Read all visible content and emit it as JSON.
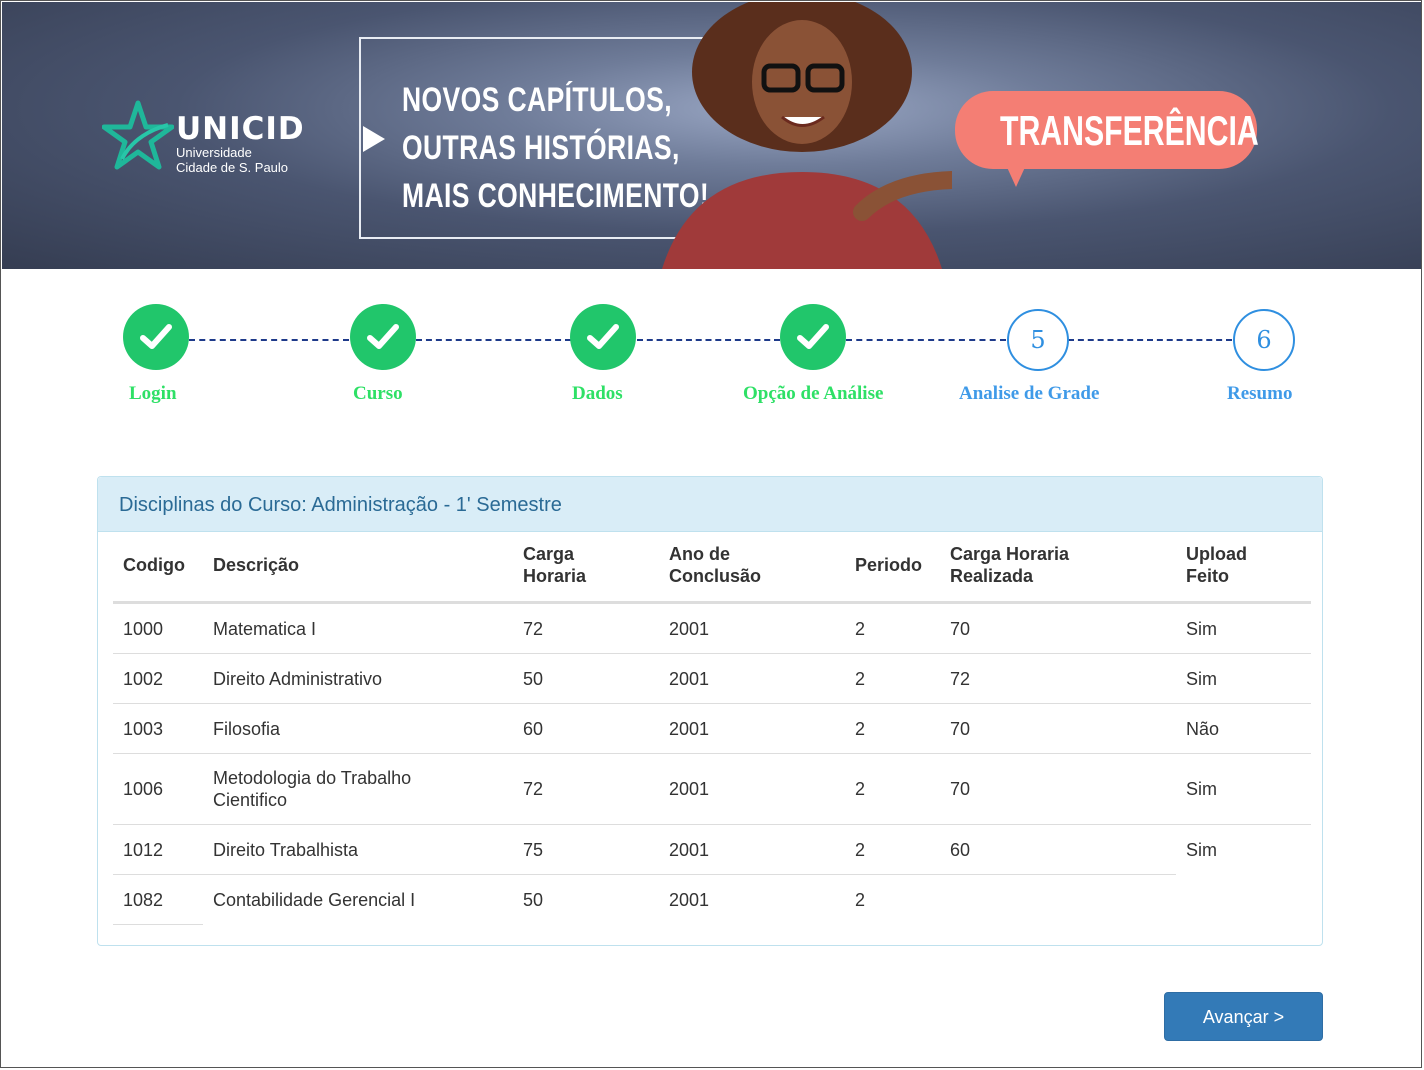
{
  "banner": {
    "logo_brand": "UNICID",
    "logo_line1": "Universidade",
    "logo_line2": "Cidade de S. Paulo",
    "slogan_line1": "NOVOS CAPÍTULOS,",
    "slogan_line2": "OUTRAS HISTÓRIAS,",
    "slogan_line3": "MAIS CONHECIMENTO!",
    "bubble_text": "TRANSFERÊNCIA"
  },
  "stepper": {
    "steps": [
      {
        "label": "Login",
        "state": "done"
      },
      {
        "label": "Curso",
        "state": "done"
      },
      {
        "label": "Dados",
        "state": "done"
      },
      {
        "label": "Opção de Análise",
        "state": "done"
      },
      {
        "label": "Analise de Grade",
        "state": "todo",
        "number": "5"
      },
      {
        "label": "Resumo",
        "state": "todo",
        "number": "6"
      }
    ],
    "done_color": "#21c66b",
    "todo_color": "#2f8fe0"
  },
  "panel": {
    "title": "Disciplinas do Curso: Administração - 1' Semestre",
    "headers": {
      "codigo": "Codigo",
      "descricao": "Descrição",
      "carga_l1": "Carga",
      "carga_l2": "Horaria",
      "ano_l1": "Ano de",
      "ano_l2": "Conclusão",
      "periodo": "Periodo",
      "realizada_l1": "Carga Horaria",
      "realizada_l2": "Realizada",
      "upload_l1": "Upload",
      "upload_l2": "Feito"
    },
    "rows": [
      {
        "codigo": "1000",
        "descricao_l1": "Matematica I",
        "descricao_l2": "",
        "carga": "72",
        "ano": "2001",
        "periodo": "2",
        "realizada": "70",
        "upload": "Sim"
      },
      {
        "codigo": "1002",
        "descricao_l1": "Direito Administrativo",
        "descricao_l2": "",
        "carga": "50",
        "ano": "2001",
        "periodo": "2",
        "realizada": "72",
        "upload": "Sim"
      },
      {
        "codigo": "1003",
        "descricao_l1": "Filosofia",
        "descricao_l2": "",
        "carga": "60",
        "ano": "2001",
        "periodo": "2",
        "realizada": "70",
        "upload": "Não"
      },
      {
        "codigo": "1006",
        "descricao_l1": "Metodologia do Trabalho",
        "descricao_l2": "Cientifico",
        "carga": "72",
        "ano": "2001",
        "periodo": "2",
        "realizada": "70",
        "upload": "Sim"
      },
      {
        "codigo": "1012",
        "descricao_l1": "Direito Trabalhista",
        "descricao_l2": "",
        "carga": "75",
        "ano": "2001",
        "periodo": "2",
        "realizada": "60",
        "upload": "Sim"
      },
      {
        "codigo": "1082",
        "descricao_l1": "Contabilidade Gerencial I",
        "descricao_l2": "",
        "carga": "50",
        "ano": "2001",
        "periodo": "2",
        "realizada": "",
        "upload": ""
      }
    ]
  },
  "actions": {
    "next_label": "Avançar >"
  }
}
